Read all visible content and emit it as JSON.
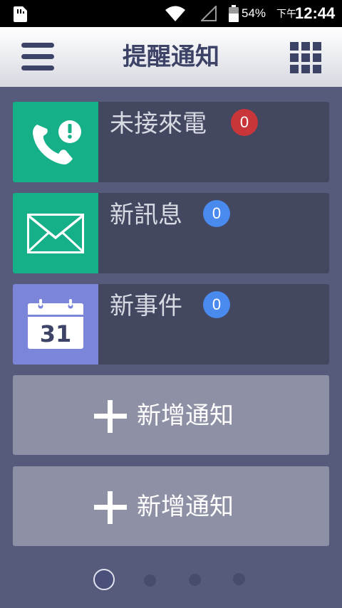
{
  "status_bar": {
    "battery_percent": "54%",
    "ampm": "下午",
    "time": "12:44",
    "icons": [
      "sim-card-icon",
      "wifi-icon",
      "no-signal-icon",
      "battery-icon"
    ]
  },
  "header": {
    "title": "提醒通知",
    "menu_icon": "hamburger-menu-icon",
    "apps_icon": "app-grid-icon"
  },
  "cards": [
    {
      "label": "未接來電",
      "count": "0",
      "icon": "missed-call-icon",
      "tile_color": "#15b088",
      "badge_color": "#c9363a"
    },
    {
      "label": "新訊息",
      "count": "0",
      "icon": "envelope-icon",
      "tile_color": "#15b088",
      "badge_color": "#4a8aef"
    },
    {
      "label": "新事件",
      "count": "0",
      "icon": "calendar-icon",
      "tile_color": "#7b86da",
      "badge_color": "#4a8aef",
      "calendar_day": "31"
    }
  ],
  "add_buttons": [
    {
      "label": "新增通知",
      "icon": "plus-icon"
    },
    {
      "label": "新增通知",
      "icon": "plus-icon"
    }
  ],
  "pager": {
    "page_count": 4,
    "active_page": 1
  }
}
